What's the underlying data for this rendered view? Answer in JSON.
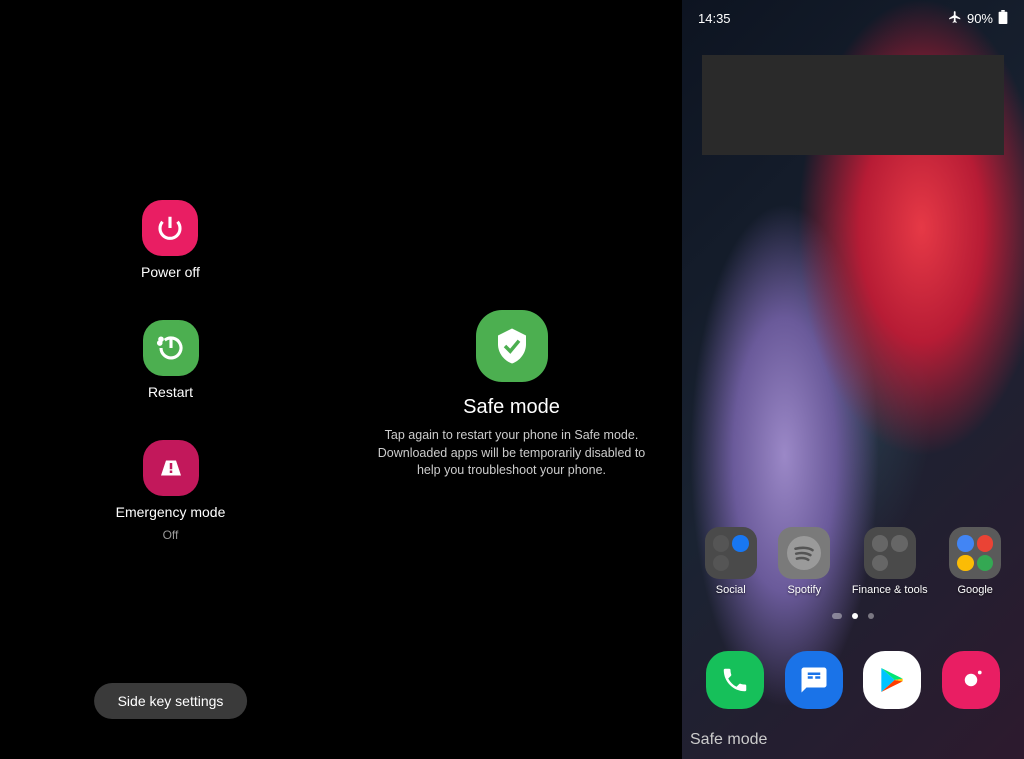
{
  "panel1": {
    "items": [
      {
        "label": "Power off",
        "iconColor": "#e91e63",
        "icon": "power"
      },
      {
        "label": "Restart",
        "iconColor": "#4caf50",
        "icon": "restart"
      },
      {
        "label": "Emergency mode",
        "sublabel": "Off",
        "iconColor": "#c2185b",
        "icon": "emergency"
      }
    ],
    "sideKeyBtn": "Side key settings"
  },
  "panel2": {
    "title": "Safe mode",
    "description": "Tap again to restart your phone in Safe mode. Downloaded apps will be temporarily disabled to help you troubleshoot your phone."
  },
  "panel3": {
    "statusTime": "14:35",
    "statusBattery": "90%",
    "airplaneMode": true,
    "apps": [
      {
        "label": "Social"
      },
      {
        "label": "Spotify"
      },
      {
        "label": "Finance & tools"
      },
      {
        "label": "Google"
      }
    ],
    "safemodeLabel": "Safe mode"
  }
}
